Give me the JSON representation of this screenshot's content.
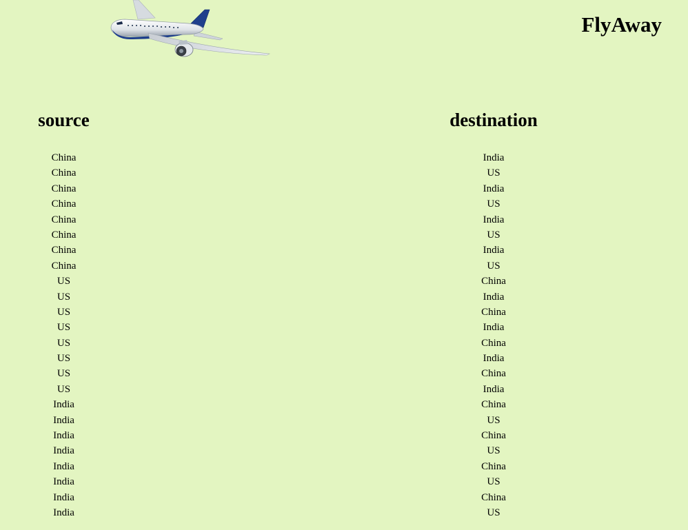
{
  "header": {
    "brand": "FlyAway",
    "logo_icon": "airplane-icon"
  },
  "columns": {
    "source_heading": "source",
    "destination_heading": "destination"
  },
  "routes": [
    {
      "source": "China",
      "destination": "India"
    },
    {
      "source": "China",
      "destination": "US"
    },
    {
      "source": "China",
      "destination": "India"
    },
    {
      "source": "China",
      "destination": "US"
    },
    {
      "source": "China",
      "destination": "India"
    },
    {
      "source": "China",
      "destination": "US"
    },
    {
      "source": "China",
      "destination": "India"
    },
    {
      "source": "China",
      "destination": "US"
    },
    {
      "source": "US",
      "destination": "China"
    },
    {
      "source": "US",
      "destination": "India"
    },
    {
      "source": "US",
      "destination": "China"
    },
    {
      "source": "US",
      "destination": "India"
    },
    {
      "source": "US",
      "destination": "China"
    },
    {
      "source": "US",
      "destination": "India"
    },
    {
      "source": "US",
      "destination": "China"
    },
    {
      "source": "US",
      "destination": "India"
    },
    {
      "source": "India",
      "destination": "China"
    },
    {
      "source": "India",
      "destination": "US"
    },
    {
      "source": "India",
      "destination": "China"
    },
    {
      "source": "India",
      "destination": "US"
    },
    {
      "source": "India",
      "destination": "China"
    },
    {
      "source": "India",
      "destination": "US"
    },
    {
      "source": "India",
      "destination": "China"
    },
    {
      "source": "India",
      "destination": "US"
    }
  ],
  "colors": {
    "background": "#e3f5c1",
    "plane_stripe": "#1f3f8c"
  }
}
